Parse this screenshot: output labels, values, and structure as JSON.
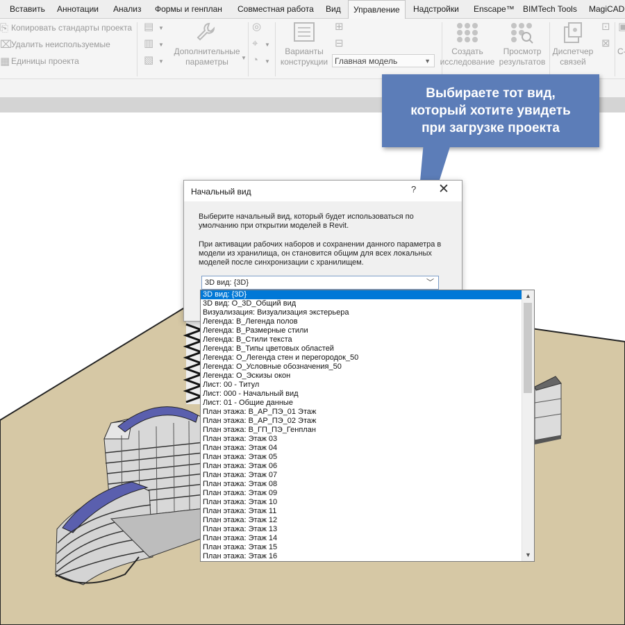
{
  "ribbon": {
    "tabs": [
      {
        "label": "Вставить"
      },
      {
        "label": "Аннотации"
      },
      {
        "label": "Анализ"
      },
      {
        "label": "Формы и генплан"
      },
      {
        "label": "Совместная работа"
      },
      {
        "label": "Вид"
      },
      {
        "label": "Управление",
        "active": true
      },
      {
        "label": "Надстройки"
      },
      {
        "label": "Enscape™"
      },
      {
        "label": "BIMTech Tools"
      },
      {
        "label": "MagiCAD"
      }
    ],
    "project_group": {
      "copy_standards": "Копировать стандарты проекта",
      "purge_unused": "Удалить неиспользуемые",
      "project_units": "Единицы проекта"
    },
    "additional_settings": "Дополнительные\nпараметры",
    "design_options": "Варианты\nконструкции",
    "main_model": "Главная модель",
    "create_study": "Создать\nисследование",
    "view_results": "Просмотр\nрезультатов",
    "links_manager": "Диспетчер\nсвязей",
    "cut_label": "С-"
  },
  "callout": {
    "text": "Выбираете тот вид,\nкоторый хотите увидеть\nпри загрузке проекта"
  },
  "dialog": {
    "title": "Начальный вид",
    "help": "?",
    "close": "✕",
    "description1": "Выберите начальный вид, который будет использоваться по\nумолчанию при открытии моделей в Revit.",
    "description2": "При активации рабочих наборов и сохранении данного параметра в\nмодели из хранилища, он становится общим для всех локальных\nмоделей после синхронизации с хранилищем.",
    "selected_view": "3D вид: {3D}"
  },
  "views": [
    "3D вид: {3D}",
    "3D вид: О_3D_Общий вид",
    "Визуализация: Визуализация экстерьера",
    "Легенда: В_Легенда полов",
    "Легенда: В_Размерные стили",
    "Легенда: В_Стили текста",
    "Легенда: В_Типы цветовых областей",
    "Легенда: О_Легенда стен и перегородок_50",
    "Легенда: О_Условные обозначения_50",
    "Легенда: О_Эскизы окон",
    "Лист: 00 - Титул",
    "Лист: 000 - Начальный вид",
    "Лист: 01 - Общие данные",
    "План этажа: В_АР_ПЭ_01 Этаж",
    "План этажа: В_АР_ПЭ_02 Этаж",
    "План этажа: В_ГП_ПЭ_Генплан",
    "План этажа: Этаж 03",
    "План этажа: Этаж 04",
    "План этажа: Этаж 05",
    "План этажа: Этаж 06",
    "План этажа: Этаж 07",
    "План этажа: Этаж 08",
    "План этажа: Этаж 09",
    "План этажа: Этаж 10",
    "План этажа: Этаж 11",
    "План этажа: Этаж 12",
    "План этажа: Этаж 13",
    "План этажа: Этаж 14",
    "План этажа: Этаж 15",
    "План этажа: Этаж 16"
  ],
  "colors": {
    "callout": "#5c7db8",
    "selection": "#0078d7",
    "ground": "#d6c8a5",
    "roof": "#5a5fae"
  }
}
